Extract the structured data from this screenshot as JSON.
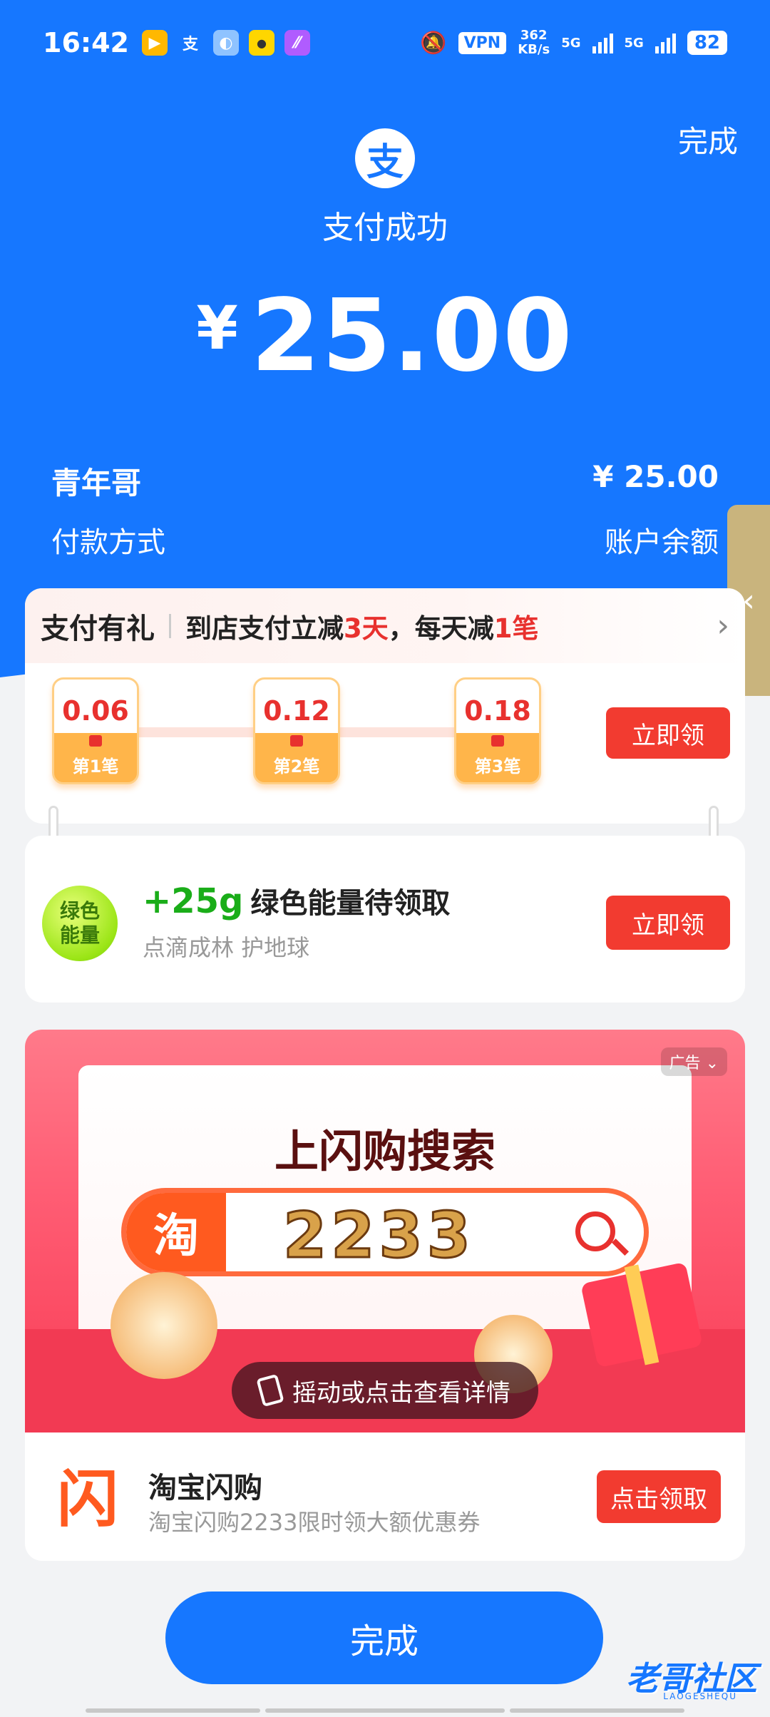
{
  "status_bar": {
    "time": "16:42",
    "vpn": "VPN",
    "speed_value": "362",
    "speed_unit": "KB/s",
    "net1": "5G",
    "net2": "5G",
    "battery": "82",
    "icons": [
      "app-icon-1",
      "alipay-icon",
      "app-icon-3",
      "app-icon-4",
      "app-icon-5",
      "mute-bell-icon"
    ]
  },
  "header": {
    "done_label": "完成",
    "logo_glyph": "支",
    "title": "支付成功",
    "currency": "¥",
    "amount": "25.00"
  },
  "details": {
    "payee": "青年哥",
    "payee_amount": "¥ 25.00",
    "method_label": "付款方式",
    "method_value": "账户余额"
  },
  "gift": {
    "title": "支付有礼",
    "sub_prefix": "到店支付立减",
    "sub_days": "3天",
    "sub_mid": "，每天减",
    "sub_count": "1笔",
    "coupons": [
      {
        "value": "0.06",
        "label": "第1笔"
      },
      {
        "value": "0.12",
        "label": "第2笔"
      },
      {
        "value": "0.18",
        "label": "第3笔"
      }
    ],
    "claim_label": "立即领"
  },
  "energy": {
    "ball_text": "绿色能量",
    "amount": "+25g",
    "title": "绿色能量待领取",
    "subtitle": "点滴成林 护地球",
    "claim_label": "立即领"
  },
  "ad": {
    "tag": "广告",
    "headline": "上闪购搜索",
    "taobao_glyph": "淘",
    "code": "2233",
    "shake_text": "摇动或点击查看详情",
    "logo_glyph": "闪",
    "brand": "淘宝闪购",
    "description": "淘宝闪购2233限时领大额优惠券",
    "cta_label": "点击领取"
  },
  "footer": {
    "done_label": "完成",
    "watermark": "老哥社区",
    "watermark_sub": "LAOGESHEQU"
  },
  "colors": {
    "brand_blue": "#1677ff",
    "accent_red": "#f23b30",
    "energy_green": "#1aad19"
  }
}
